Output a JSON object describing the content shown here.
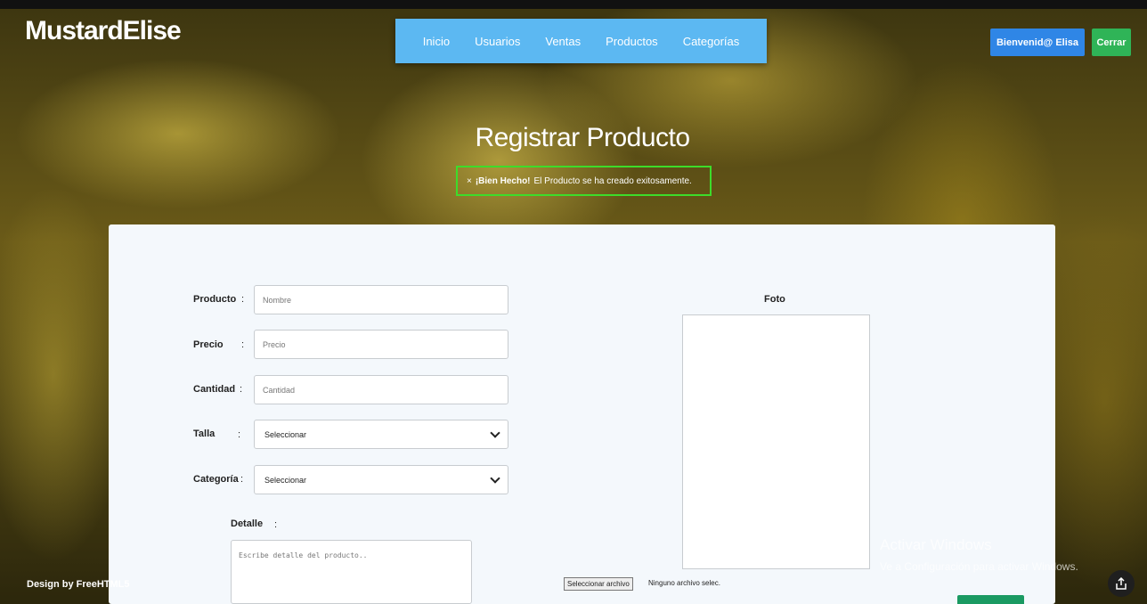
{
  "brand": "MustardElise",
  "nav": {
    "items": [
      "Inicio",
      "Usuarios",
      "Ventas",
      "Productos",
      "Categorías"
    ]
  },
  "header": {
    "welcome": "Bienvenid@ Elisa",
    "logout": "Cerrar"
  },
  "page": {
    "title": "Registrar Producto"
  },
  "alert": {
    "close": "×",
    "strong": "¡Bien Hecho!",
    "message": "El Producto se ha creado exitosamente."
  },
  "form": {
    "producto": {
      "label": "Producto",
      "colon": ":",
      "placeholder": "Nombre"
    },
    "precio": {
      "label": "Precio",
      "colon": ":",
      "placeholder": "Precio"
    },
    "cantidad": {
      "label": "Cantidad",
      "colon": ":",
      "placeholder": "Cantidad"
    },
    "talla": {
      "label": "Talla",
      "colon": ":",
      "selected": "Seleccionar"
    },
    "categoria": {
      "label": "Categoría",
      "colon": ":",
      "selected": "Seleccionar"
    },
    "detalle": {
      "label": "Detalle",
      "colon": ":",
      "placeholder": "Escribe detalle del producto.."
    },
    "foto": {
      "label": "Foto",
      "file_button": "Seleccionar archivo",
      "file_status": "Ninguno archivo selec."
    }
  },
  "footer": {
    "credit": "Design by FreeHTML5"
  },
  "windows_watermark": {
    "line1": "Activar Windows",
    "line2": "Ve a Configuración para activar Windows."
  },
  "colors": {
    "nav_bg": "#5cb8f2",
    "welcome_btn": "#2f86e6",
    "logout_btn": "#2fb457",
    "alert_border": "#3ddc2a",
    "card_bg": "#f4f8fc"
  }
}
